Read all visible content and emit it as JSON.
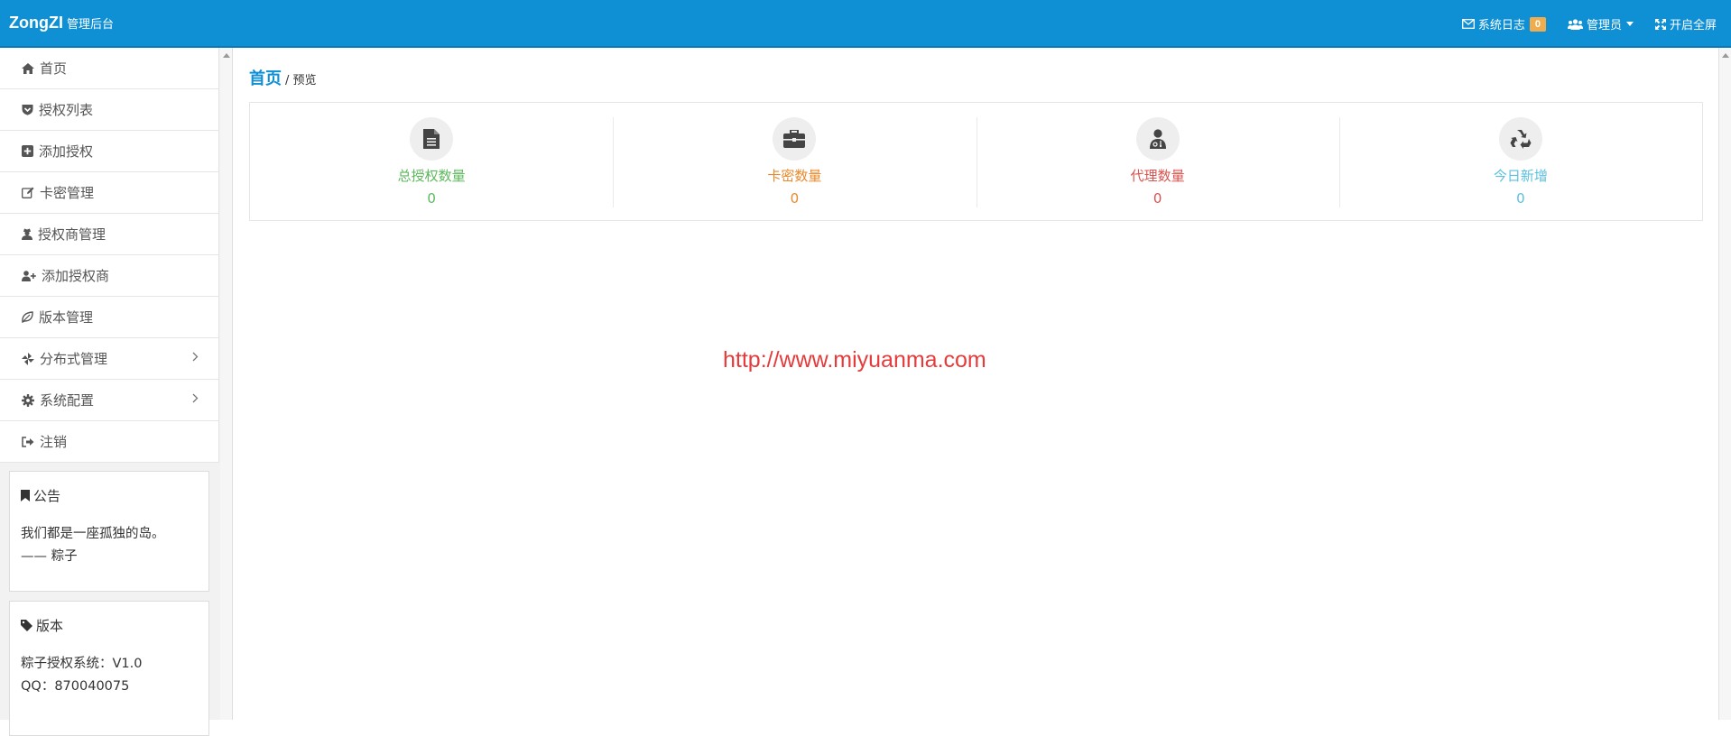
{
  "header": {
    "brand": "ZongZI",
    "brand_sub": "管理后台",
    "log_label": "系统日志",
    "log_count": "0",
    "admin_label": "管理员",
    "fullscreen_label": "开启全屏"
  },
  "sidebar": {
    "items": [
      {
        "label": "首页",
        "icon": "home-icon"
      },
      {
        "label": "授权列表",
        "icon": "shield-icon"
      },
      {
        "label": "添加授权",
        "icon": "plus-square-icon"
      },
      {
        "label": "卡密管理",
        "icon": "edit-icon"
      },
      {
        "label": "授权商管理",
        "icon": "user-secret-icon"
      },
      {
        "label": "添加授权商",
        "icon": "user-plus-icon"
      },
      {
        "label": "版本管理",
        "icon": "leaf-icon"
      },
      {
        "label": "分布式管理",
        "icon": "pinwheel-icon"
      },
      {
        "label": "系统配置",
        "icon": "gear-icon"
      },
      {
        "label": "注销",
        "icon": "sign-out-icon"
      }
    ],
    "notice": {
      "title": "公告",
      "line1": "我们都是一座孤独的岛。",
      "line2": "—— 粽子"
    },
    "version": {
      "title": "版本",
      "line1": "粽子授权系统：V1.0",
      "line2": "QQ：870040075"
    }
  },
  "main": {
    "breadcrumb_home": "首页",
    "breadcrumb_sep_page": "/ 预览",
    "stats": [
      {
        "label": "总授权数量",
        "value": "0",
        "color": "#5cb85c",
        "icon": "file-icon"
      },
      {
        "label": "卡密数量",
        "value": "0",
        "color": "#e8892b",
        "icon": "briefcase-icon"
      },
      {
        "label": "代理数量",
        "value": "0",
        "color": "#d9534f",
        "icon": "user-md-icon"
      },
      {
        "label": "今日新增",
        "value": "0",
        "color": "#5bc0de",
        "icon": "recycle-icon"
      }
    ],
    "watermark": "http://www.miyuanma.com"
  },
  "colors": {
    "topbar": "#0f8fd4",
    "badge": "#f0ad4e"
  }
}
